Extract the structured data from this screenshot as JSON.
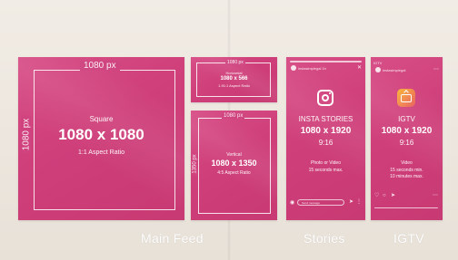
{
  "square": {
    "width_label": "1080 px",
    "height_label": "1080 px",
    "name": "Square",
    "size": "1080 x 1080",
    "ratio": "1:1 Aspect Ratio"
  },
  "horizontal": {
    "width_label": "1080 px",
    "name": "Horizontal",
    "size": "1080 x 566",
    "ratio": "1.91:1 Aspect Ratio"
  },
  "vertical": {
    "width_label": "1080 px",
    "height_label": "1350 px",
    "name": "Vertical",
    "size": "1080 x 1350",
    "ratio": "4:5 Aspect Ratio"
  },
  "stories": {
    "handle": "instasimplegal  1h",
    "title": "INSTA STORIES",
    "size": "1080 x 1920",
    "ratio": "9:16",
    "media": "Photo or Video",
    "limit": "15 seconds max.",
    "message_placeholder": "Send message"
  },
  "igtv": {
    "top_label": "IGTV",
    "handle": "instasimplegal",
    "title": "IGTV",
    "size": "1080 x 1920",
    "ratio": "9:16",
    "media": "Video",
    "min": "15 seconds min.",
    "max": "10 minutes max."
  },
  "captions": {
    "main_feed": "Main Feed",
    "stories": "Stories",
    "igtv": "IGTV"
  },
  "colors": {
    "panel": "#cf3f7a",
    "background": "#ece6de"
  },
  "icons": [
    "instagram-icon",
    "igtv-icon",
    "camera-icon",
    "send-icon",
    "heart-icon",
    "comment-icon",
    "share-icon",
    "more-icon"
  ]
}
